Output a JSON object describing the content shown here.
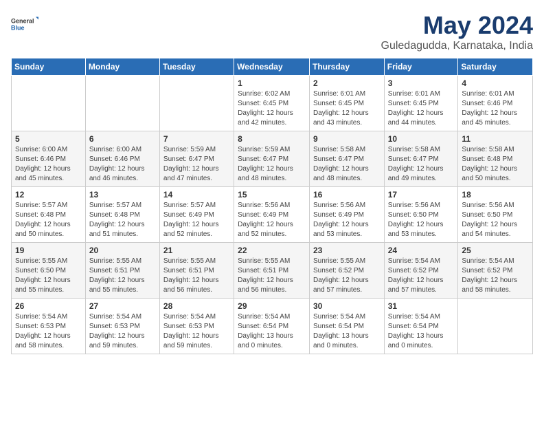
{
  "header": {
    "logo": {
      "general": "General",
      "blue": "Blue"
    },
    "title": "May 2024",
    "subtitle": "Guledagudda, Karnataka, India"
  },
  "weekdays": [
    "Sunday",
    "Monday",
    "Tuesday",
    "Wednesday",
    "Thursday",
    "Friday",
    "Saturday"
  ],
  "weeks": [
    [
      {
        "day": "",
        "info": ""
      },
      {
        "day": "",
        "info": ""
      },
      {
        "day": "",
        "info": ""
      },
      {
        "day": "1",
        "info": "Sunrise: 6:02 AM\nSunset: 6:45 PM\nDaylight: 12 hours\nand 42 minutes."
      },
      {
        "day": "2",
        "info": "Sunrise: 6:01 AM\nSunset: 6:45 PM\nDaylight: 12 hours\nand 43 minutes."
      },
      {
        "day": "3",
        "info": "Sunrise: 6:01 AM\nSunset: 6:45 PM\nDaylight: 12 hours\nand 44 minutes."
      },
      {
        "day": "4",
        "info": "Sunrise: 6:01 AM\nSunset: 6:46 PM\nDaylight: 12 hours\nand 45 minutes."
      }
    ],
    [
      {
        "day": "5",
        "info": "Sunrise: 6:00 AM\nSunset: 6:46 PM\nDaylight: 12 hours\nand 45 minutes."
      },
      {
        "day": "6",
        "info": "Sunrise: 6:00 AM\nSunset: 6:46 PM\nDaylight: 12 hours\nand 46 minutes."
      },
      {
        "day": "7",
        "info": "Sunrise: 5:59 AM\nSunset: 6:47 PM\nDaylight: 12 hours\nand 47 minutes."
      },
      {
        "day": "8",
        "info": "Sunrise: 5:59 AM\nSunset: 6:47 PM\nDaylight: 12 hours\nand 48 minutes."
      },
      {
        "day": "9",
        "info": "Sunrise: 5:58 AM\nSunset: 6:47 PM\nDaylight: 12 hours\nand 48 minutes."
      },
      {
        "day": "10",
        "info": "Sunrise: 5:58 AM\nSunset: 6:47 PM\nDaylight: 12 hours\nand 49 minutes."
      },
      {
        "day": "11",
        "info": "Sunrise: 5:58 AM\nSunset: 6:48 PM\nDaylight: 12 hours\nand 50 minutes."
      }
    ],
    [
      {
        "day": "12",
        "info": "Sunrise: 5:57 AM\nSunset: 6:48 PM\nDaylight: 12 hours\nand 50 minutes."
      },
      {
        "day": "13",
        "info": "Sunrise: 5:57 AM\nSunset: 6:48 PM\nDaylight: 12 hours\nand 51 minutes."
      },
      {
        "day": "14",
        "info": "Sunrise: 5:57 AM\nSunset: 6:49 PM\nDaylight: 12 hours\nand 52 minutes."
      },
      {
        "day": "15",
        "info": "Sunrise: 5:56 AM\nSunset: 6:49 PM\nDaylight: 12 hours\nand 52 minutes."
      },
      {
        "day": "16",
        "info": "Sunrise: 5:56 AM\nSunset: 6:49 PM\nDaylight: 12 hours\nand 53 minutes."
      },
      {
        "day": "17",
        "info": "Sunrise: 5:56 AM\nSunset: 6:50 PM\nDaylight: 12 hours\nand 53 minutes."
      },
      {
        "day": "18",
        "info": "Sunrise: 5:56 AM\nSunset: 6:50 PM\nDaylight: 12 hours\nand 54 minutes."
      }
    ],
    [
      {
        "day": "19",
        "info": "Sunrise: 5:55 AM\nSunset: 6:50 PM\nDaylight: 12 hours\nand 55 minutes."
      },
      {
        "day": "20",
        "info": "Sunrise: 5:55 AM\nSunset: 6:51 PM\nDaylight: 12 hours\nand 55 minutes."
      },
      {
        "day": "21",
        "info": "Sunrise: 5:55 AM\nSunset: 6:51 PM\nDaylight: 12 hours\nand 56 minutes."
      },
      {
        "day": "22",
        "info": "Sunrise: 5:55 AM\nSunset: 6:51 PM\nDaylight: 12 hours\nand 56 minutes."
      },
      {
        "day": "23",
        "info": "Sunrise: 5:55 AM\nSunset: 6:52 PM\nDaylight: 12 hours\nand 57 minutes."
      },
      {
        "day": "24",
        "info": "Sunrise: 5:54 AM\nSunset: 6:52 PM\nDaylight: 12 hours\nand 57 minutes."
      },
      {
        "day": "25",
        "info": "Sunrise: 5:54 AM\nSunset: 6:52 PM\nDaylight: 12 hours\nand 58 minutes."
      }
    ],
    [
      {
        "day": "26",
        "info": "Sunrise: 5:54 AM\nSunset: 6:53 PM\nDaylight: 12 hours\nand 58 minutes."
      },
      {
        "day": "27",
        "info": "Sunrise: 5:54 AM\nSunset: 6:53 PM\nDaylight: 12 hours\nand 59 minutes."
      },
      {
        "day": "28",
        "info": "Sunrise: 5:54 AM\nSunset: 6:53 PM\nDaylight: 12 hours\nand 59 minutes."
      },
      {
        "day": "29",
        "info": "Sunrise: 5:54 AM\nSunset: 6:54 PM\nDaylight: 13 hours\nand 0 minutes."
      },
      {
        "day": "30",
        "info": "Sunrise: 5:54 AM\nSunset: 6:54 PM\nDaylight: 13 hours\nand 0 minutes."
      },
      {
        "day": "31",
        "info": "Sunrise: 5:54 AM\nSunset: 6:54 PM\nDaylight: 13 hours\nand 0 minutes."
      },
      {
        "day": "",
        "info": ""
      }
    ]
  ]
}
